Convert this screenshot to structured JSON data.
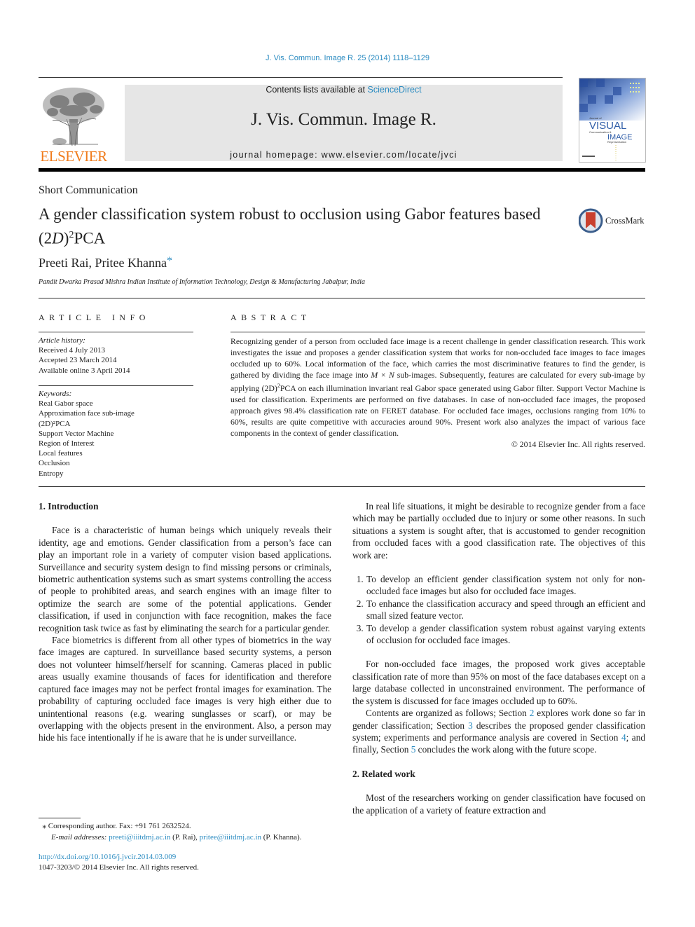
{
  "header": {
    "citation": "J. Vis. Commun. Image R. 25 (2014) 1118–1129",
    "contents_prefix": "Contents lists available at ",
    "contents_link": "ScienceDirect",
    "journal_title": "J. Vis. Commun. Image R.",
    "homepage": "journal homepage: www.elsevier.com/locate/jvci",
    "publisher_logo_text": "ELSEVIER",
    "cover": {
      "line1": "Journal of",
      "line2": "VISUAL",
      "line3": "Communication &",
      "line4": "IMAGE",
      "line5": "Representation"
    },
    "colors": {
      "link": "#2a8bc1",
      "elsevier_orange": "#f07b1b",
      "banner_bg": "#e6e6e6"
    }
  },
  "article": {
    "type": "Short Communication",
    "title_main": "A gender classification system robust to occlusion using Gabor features based (2",
    "title_italic": "D",
    "title_close": ")",
    "title_sup": "2",
    "title_tail": "PCA",
    "crossmark_label": "CrossMark",
    "authors": "Preeti Rai, Pritee Khanna",
    "author_mark": "*",
    "affiliation": "Pandit Dwarka Prasad Mishra Indian Institute of Information Technology, Design & Manufacturing Jabalpur, India"
  },
  "article_info": {
    "heading": "ARTICLE INFO",
    "history_label": "Article history:",
    "history": [
      "Received 4 July 2013",
      "Accepted 23 March 2014",
      "Available online 3 April 2014"
    ],
    "keywords_label": "Keywords:",
    "keywords": [
      "Real Gabor space",
      "Approximation face sub-image",
      "(2D)²PCA",
      "Support Vector Machine",
      "Region of Interest",
      "Local features",
      "Occlusion",
      "Entropy"
    ]
  },
  "abstract": {
    "heading": "ABSTRACT",
    "part1": "Recognizing gender of a person from occluded face image is a recent challenge in gender classification research. This work investigates the issue and proposes a gender classification system that works for non-occluded face images to face images occluded up to 60%. Local information of the face, which carries the most discriminative features to find the gender, is gathered by dividing the face image into ",
    "mxn": "M × N",
    "part2": " sub-images. Subsequently, features are calculated for every sub-image by applying (2D)",
    "sup": "2",
    "part3": "PCA on each illumination invariant real Gabor space generated using Gabor filter. Support Vector Machine is used for classification. Experiments are performed on five databases. In case of non-occluded face images, the proposed approach gives 98.4% classification rate on FERET database. For occluded face images, occlusions ranging from 10% to 60%, results are quite competitive with accuracies around 90%. Present work also analyzes the impact of various face components in the context of gender classification.",
    "copyright": "© 2014 Elsevier Inc. All rights reserved."
  },
  "body": {
    "sec1_heading": "1. Introduction",
    "sec1_p1": "Face is a characteristic of human beings which uniquely reveals their identity, age and emotions. Gender classification from a person’s face can play an important role in a variety of computer vision based applications. Surveillance and security system design to find missing persons or criminals, biometric authentication systems such as smart systems controlling the access of people to prohibited areas, and search engines with an image filter to optimize the search are some of the potential applications. Gender classification, if used in conjunction with face recognition, makes the face recognition task twice as fast by eliminating the search for a particular gender.",
    "sec1_p2": "Face biometrics is different from all other types of biometrics in the way face images are captured. In surveillance based security systems, a person does not volunteer himself/herself for scanning. Cameras placed in public areas usually examine thousands of faces for identification and therefore captured face images may not be perfect frontal images for examination. The probability of capturing occluded face images is very high either due to unintentional reasons (e.g. wearing sunglasses or scarf), or may be overlapping with the objects present in the environment. Also, a person may hide his face intentionally if he is aware that he is under surveillance.",
    "sec1_p3": "In real life situations, it might be desirable to recognize gender from a face which may be partially occluded due to injury or some other reasons. In such situations a system is sought after, that is accustomed to gender recognition from occluded faces with a good classification rate. The objectives of this work are:",
    "objectives": [
      "To develop an efficient gender classification system not only for non-occluded face images but also for occluded face images.",
      "To enhance the classification accuracy and speed through an efficient and small sized feature vector.",
      "To develop a gender classification system robust against varying extents of occlusion for occluded face images."
    ],
    "sec1_p4": "For non-occluded face images, the proposed work gives acceptable classification rate of more than 95% on most of the face databases except on a large database collected in unconstrained environment. The performance of the system is discussed for face images occluded up to 60%.",
    "sec1_p5_a": "Contents are organized as follows; Section ",
    "sec1_p5_ref1": "2",
    "sec1_p5_b": " explores work done so far in gender classification; Section ",
    "sec1_p5_ref2": "3",
    "sec1_p5_c": " describes the proposed gender classification system; experiments and performance analysis are covered in Section ",
    "sec1_p5_ref3": "4",
    "sec1_p5_d": "; and finally, Section ",
    "sec1_p5_ref4": "5",
    "sec1_p5_e": " concludes the work along with the future scope.",
    "sec2_heading": "2. Related work",
    "sec2_p1": "Most of the researchers working on gender classification have focused on the application of a variety of feature extraction and"
  },
  "footnotes": {
    "star": "⁎",
    "corresponding": "Corresponding author. Fax: +91 761 2632524.",
    "email_label": "E-mail addresses:",
    "email1": "preeti@iiitdmj.ac.in",
    "email1_name": " (P. Rai), ",
    "email2": "pritee@iiitdmj.ac.in",
    "email2_name": " (P. Khanna).",
    "doi": "http://dx.doi.org/10.1016/j.jvcir.2014.03.009",
    "issn": "1047-3203/© 2014 Elsevier Inc. All rights reserved."
  }
}
